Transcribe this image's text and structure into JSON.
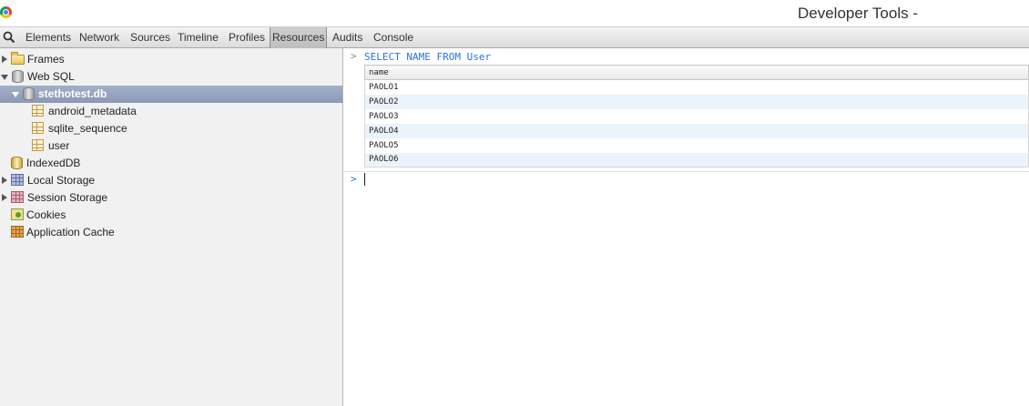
{
  "window": {
    "title": "Developer Tools -",
    "app_icon": "chrome-icon"
  },
  "toolbar": {
    "search_icon": "search-icon",
    "tabs": [
      {
        "label": "Elements",
        "selected": false
      },
      {
        "label": "Network",
        "selected": false
      },
      {
        "label": "Sources",
        "selected": false
      },
      {
        "label": "Timeline",
        "selected": false
      },
      {
        "label": "Profiles",
        "selected": false
      },
      {
        "label": "Resources",
        "selected": true
      },
      {
        "label": "Audits",
        "selected": false
      },
      {
        "label": "Console",
        "selected": false
      }
    ]
  },
  "sidebar": {
    "items": [
      {
        "label": "Frames",
        "icon": "folder-icon",
        "expander": "collapsed",
        "depth": 0
      },
      {
        "label": "Web SQL",
        "icon": "database-icon",
        "expander": "expanded",
        "depth": 0
      },
      {
        "label": "stethotest.db",
        "icon": "database-icon",
        "expander": "expanded",
        "depth": 1,
        "selected": true
      },
      {
        "label": "android_metadata",
        "icon": "table-icon",
        "depth": 2
      },
      {
        "label": "sqlite_sequence",
        "icon": "table-icon",
        "depth": 2
      },
      {
        "label": "user",
        "icon": "table-icon",
        "depth": 2
      },
      {
        "label": "IndexedDB",
        "icon": "database-icon",
        "depth": 0
      },
      {
        "label": "Local Storage",
        "icon": "grid-icon",
        "expander": "collapsed",
        "depth": 0
      },
      {
        "label": "Session Storage",
        "icon": "grid-icon",
        "expander": "collapsed",
        "depth": 0
      },
      {
        "label": "Cookies",
        "icon": "cookie-icon",
        "depth": 0
      },
      {
        "label": "Application Cache",
        "icon": "cache-icon",
        "depth": 0
      }
    ]
  },
  "console": {
    "prompt_symbol": ">",
    "query": "SELECT NAME FROM User",
    "result": {
      "columns": [
        "name"
      ],
      "rows": [
        [
          "PAOLO1"
        ],
        [
          "PAOLO2"
        ],
        [
          "PAOLO3"
        ],
        [
          "PAOLO4"
        ],
        [
          "PAOLO5"
        ],
        [
          "PAOLO6"
        ]
      ]
    },
    "input_value": ""
  },
  "colors": {
    "accent": "#2d72d9",
    "selection": "#8a99b8",
    "alt_row": "#ebf3fd"
  }
}
